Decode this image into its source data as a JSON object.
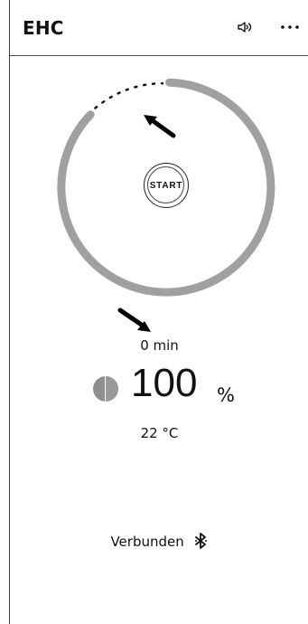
{
  "header": {
    "title": "EHC",
    "icons": {
      "sound": "speaker-icon",
      "more": "more-icon"
    }
  },
  "timer": {
    "start_label": "START",
    "time_value": "0 min",
    "remaining_fraction": 0.82
  },
  "power": {
    "value": "100",
    "unit": "%",
    "icon": "half-circle-icon"
  },
  "temperature": {
    "value": "22 °C"
  },
  "status": {
    "label": "Verbunden",
    "icon": "bluetooth-icon"
  },
  "colors": {
    "ring": "#a0a0a0",
    "text": "#111111",
    "icon_gray": "#8e8e8e",
    "border": "#4a4a4a"
  }
}
